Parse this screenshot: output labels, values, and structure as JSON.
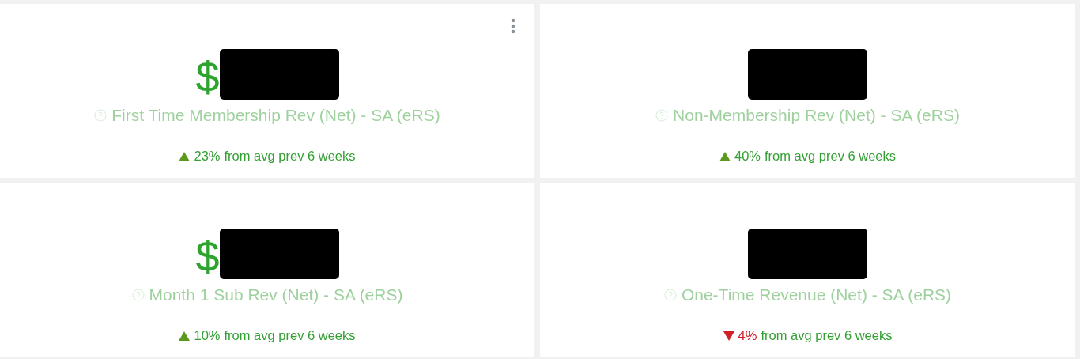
{
  "cards": [
    {
      "value": "$",
      "title": "First Time Membership Rev (Net) - SA (eRS)",
      "increase": true,
      "change": "23%",
      "comparison": "from avg prev 6 weeks",
      "menu": true
    },
    {
      "title": "Non-Membership Rev (Net) - SA (eRS)",
      "increase": true,
      "change": "40%",
      "comparison": "from avg prev 6 weeks",
      "menu": false
    },
    {
      "value": "$",
      "title": "Month 1 Sub Rev (Net) - SA (eRS)",
      "increase": true,
      "change": "10%",
      "comparison": "from avg prev 6 weeks",
      "menu": false
    },
    {
      "title": "One-Time Revenue (Net) - SA (eRS)",
      "increase": false,
      "change": "4%",
      "comparison": "from avg prev 6 weeks",
      "menu": false
    }
  ]
}
